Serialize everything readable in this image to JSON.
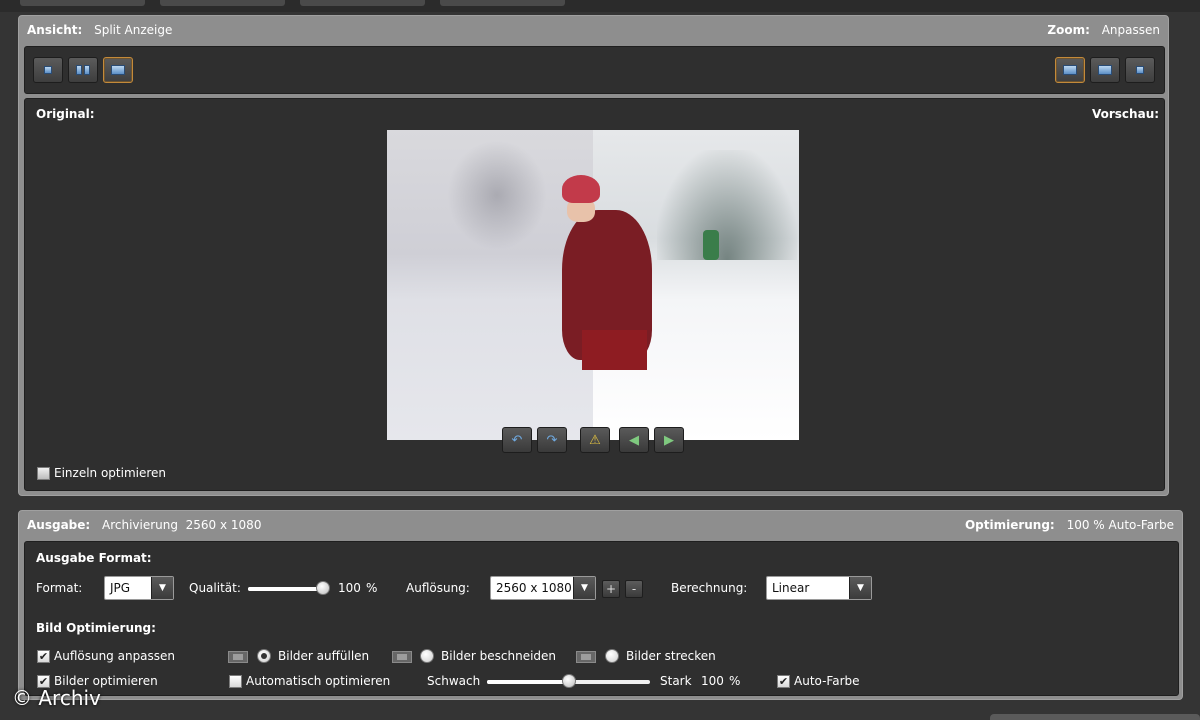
{
  "view_panel": {
    "ansicht_label": "Ansicht:",
    "ansicht_value": "Split Anzeige",
    "zoom_label": "Zoom:",
    "zoom_value": "Anpassen",
    "original_label": "Original:",
    "vorschau_label": "Vorschau:",
    "einzeln_label": "Einzeln optimieren",
    "einzeln_checked": true
  },
  "output_panel": {
    "ausgabe_label": "Ausgabe:",
    "ausgabe_value": "Archivierung  2560 x 1080",
    "optimierung_label": "Optimierung:",
    "optimierung_value": "100 % Auto-Farbe",
    "format_section": "Ausgabe Format:",
    "format_label": "Format:",
    "format_value": "JPG",
    "qualitaet_label": "Qualität:",
    "qualitaet_value": "100",
    "qualitaet_unit": "%",
    "qualitaet_level": 1.0,
    "aufloesung_label": "Auflösung:",
    "aufloesung_value": "2560 x 1080",
    "plus": "+",
    "minus": "-",
    "berechnung_label": "Berechnung:",
    "berechnung_value": "Linear",
    "bild_section": "Bild Optimierung:",
    "aufloesung_anpassen": "Auflösung anpassen",
    "bilder_auffuellen": "Bilder auffüllen",
    "bilder_beschneiden": "Bilder beschneiden",
    "bilder_strecken": "Bilder strecken",
    "bilder_optimieren": "Bilder optimieren",
    "automatisch_optimieren": "Automatisch optimieren",
    "schwach": "Schwach",
    "stark": "Stark",
    "staerke_value": "100",
    "staerke_unit": "%",
    "staerke_level": 0.5,
    "auto_farbe": "Auto-Farbe",
    "selected_fit": "Bilder auffüllen"
  },
  "checkmark": "✔",
  "watermark": "© Archiv",
  "icons": {
    "accent": "#c48a3a",
    "icon_blue": "#6fa9e0"
  }
}
